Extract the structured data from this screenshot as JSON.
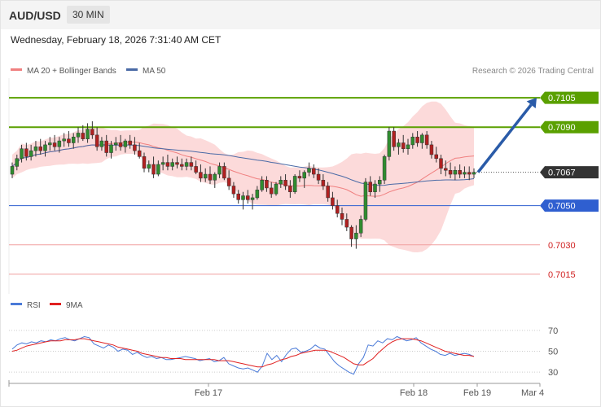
{
  "header": {
    "symbol": "AUD/USD",
    "timeframe": "30 MIN",
    "datetime": "Wednesday, February 18, 2026 7:31:40 AM CET"
  },
  "colors": {
    "bb_fill": "#fbd3d3",
    "ma20": "#f08080",
    "ma50": "#4a6aa6",
    "resistance": "#5aa000",
    "support": "#2f5fd0",
    "weak_level": "#f0a0a0",
    "weak_label": "#d02020",
    "current_label_bg": "#333333",
    "arrow": "#2a5ba8",
    "rsi": "#4a7ad8",
    "rsi_ma": "#e02020",
    "bull_candle": "#2f8c2f",
    "bear_candle": "#b02020"
  },
  "chart_data": [
    {
      "type": "candlestick",
      "legend": [
        {
          "label": "MA 20 + Bollinger Bands",
          "color": "#f08080"
        },
        {
          "label": "MA 50",
          "color": "#4a6aa6"
        }
      ],
      "watermark": "Research © 2026 Trading Central",
      "ylim": [
        0.7005,
        0.7115
      ],
      "x_ticks": [
        "Feb 17",
        "Feb 18",
        "Feb 19",
        "Mar 4"
      ],
      "levels": [
        {
          "value": "0.7105",
          "style": "resistance"
        },
        {
          "value": "0.7090",
          "style": "resistance"
        },
        {
          "value": "0.7067",
          "style": "current"
        },
        {
          "value": "0.7050",
          "style": "support"
        },
        {
          "value": "0.7030",
          "style": "weak"
        },
        {
          "value": "0.7015",
          "style": "weak"
        }
      ],
      "forecast_arrow": {
        "from": 0.7067,
        "to": 0.7105
      },
      "ohlc": [
        [
          0.7066,
          0.7072,
          0.7064,
          0.707
        ],
        [
          0.707,
          0.7076,
          0.7068,
          0.7074
        ],
        [
          0.7074,
          0.7081,
          0.7072,
          0.7079
        ],
        [
          0.7079,
          0.7082,
          0.7073,
          0.7075
        ],
        [
          0.7075,
          0.7081,
          0.7073,
          0.7078
        ],
        [
          0.7078,
          0.7083,
          0.7075,
          0.708
        ],
        [
          0.708,
          0.7084,
          0.7076,
          0.7078
        ],
        [
          0.7078,
          0.7083,
          0.7075,
          0.7081
        ],
        [
          0.7081,
          0.7085,
          0.7078,
          0.7082
        ],
        [
          0.7082,
          0.7086,
          0.7078,
          0.708
        ],
        [
          0.708,
          0.7085,
          0.7077,
          0.7083
        ],
        [
          0.7083,
          0.7087,
          0.708,
          0.7084
        ],
        [
          0.7084,
          0.7088,
          0.708,
          0.7082
        ],
        [
          0.7082,
          0.7087,
          0.7079,
          0.7085
        ],
        [
          0.7085,
          0.709,
          0.7082,
          0.7087
        ],
        [
          0.7087,
          0.7091,
          0.7083,
          0.7084
        ],
        [
          0.7084,
          0.7092,
          0.7082,
          0.7089
        ],
        [
          0.7089,
          0.7093,
          0.7084,
          0.7086
        ],
        [
          0.7086,
          0.709,
          0.7078,
          0.708
        ],
        [
          0.708,
          0.7085,
          0.7078,
          0.7083
        ],
        [
          0.7083,
          0.7086,
          0.7075,
          0.7077
        ],
        [
          0.7077,
          0.7083,
          0.7074,
          0.7081
        ],
        [
          0.7081,
          0.7085,
          0.7078,
          0.7082
        ],
        [
          0.7082,
          0.7086,
          0.7078,
          0.708
        ],
        [
          0.708,
          0.7084,
          0.7077,
          0.7083
        ],
        [
          0.7083,
          0.7086,
          0.7079,
          0.7081
        ],
        [
          0.7081,
          0.7085,
          0.7076,
          0.7078
        ],
        [
          0.7078,
          0.7082,
          0.7074,
          0.7075
        ],
        [
          0.7075,
          0.7077,
          0.7067,
          0.7069
        ],
        [
          0.7069,
          0.7073,
          0.7067,
          0.7071
        ],
        [
          0.7071,
          0.7075,
          0.7064,
          0.7066
        ],
        [
          0.7066,
          0.7073,
          0.7065,
          0.7071
        ],
        [
          0.7071,
          0.7075,
          0.7068,
          0.7072
        ],
        [
          0.7072,
          0.7076,
          0.7068,
          0.707
        ],
        [
          0.707,
          0.7074,
          0.7068,
          0.7072
        ],
        [
          0.7072,
          0.7075,
          0.7069,
          0.7071
        ],
        [
          0.7071,
          0.7074,
          0.7068,
          0.707
        ],
        [
          0.707,
          0.7074,
          0.7068,
          0.7072
        ],
        [
          0.7072,
          0.7075,
          0.7068,
          0.707
        ],
        [
          0.707,
          0.7073,
          0.7066,
          0.7067
        ],
        [
          0.7067,
          0.7071,
          0.7062,
          0.7064
        ],
        [
          0.7064,
          0.7069,
          0.7062,
          0.7066
        ],
        [
          0.7066,
          0.707,
          0.7061,
          0.7063
        ],
        [
          0.7063,
          0.7067,
          0.7059,
          0.7066
        ],
        [
          0.7066,
          0.7072,
          0.7064,
          0.707
        ],
        [
          0.707,
          0.7072,
          0.7063,
          0.7064
        ],
        [
          0.7064,
          0.7068,
          0.7058,
          0.706
        ],
        [
          0.706,
          0.7062,
          0.7054,
          0.7056
        ],
        [
          0.7056,
          0.7058,
          0.7051,
          0.7053
        ],
        [
          0.7053,
          0.7057,
          0.7048,
          0.7055
        ],
        [
          0.7055,
          0.7058,
          0.7051,
          0.7053
        ],
        [
          0.7053,
          0.7056,
          0.7048,
          0.7054
        ],
        [
          0.7054,
          0.706,
          0.7053,
          0.7058
        ],
        [
          0.7058,
          0.7065,
          0.7057,
          0.7063
        ],
        [
          0.7063,
          0.7065,
          0.7057,
          0.7059
        ],
        [
          0.7059,
          0.7062,
          0.7054,
          0.7056
        ],
        [
          0.7056,
          0.7062,
          0.7055,
          0.7061
        ],
        [
          0.7061,
          0.7065,
          0.7059,
          0.7063
        ],
        [
          0.7063,
          0.7066,
          0.7058,
          0.706
        ],
        [
          0.706,
          0.7063,
          0.7054,
          0.7057
        ],
        [
          0.7057,
          0.7066,
          0.7056,
          0.7065
        ],
        [
          0.7065,
          0.7068,
          0.7062,
          0.7064
        ],
        [
          0.7064,
          0.7068,
          0.7059,
          0.7067
        ],
        [
          0.7067,
          0.7072,
          0.7065,
          0.7069
        ],
        [
          0.7069,
          0.7071,
          0.7064,
          0.7066
        ],
        [
          0.7066,
          0.7069,
          0.7061,
          0.7063
        ],
        [
          0.7063,
          0.7066,
          0.7058,
          0.706
        ],
        [
          0.706,
          0.7062,
          0.7052,
          0.7054
        ],
        [
          0.7054,
          0.7057,
          0.7048,
          0.705
        ],
        [
          0.705,
          0.7053,
          0.7044,
          0.7046
        ],
        [
          0.7046,
          0.7049,
          0.704,
          0.7043
        ],
        [
          0.7043,
          0.7046,
          0.7037,
          0.7039
        ],
        [
          0.7039,
          0.704,
          0.7029,
          0.7033
        ],
        [
          0.7033,
          0.704,
          0.7028,
          0.7036
        ],
        [
          0.7036,
          0.7045,
          0.7034,
          0.7043
        ],
        [
          0.7043,
          0.7064,
          0.7042,
          0.7062
        ],
        [
          0.7062,
          0.7065,
          0.7055,
          0.7057
        ],
        [
          0.7057,
          0.7063,
          0.7054,
          0.7061
        ],
        [
          0.7061,
          0.7065,
          0.7057,
          0.7063
        ],
        [
          0.7063,
          0.7076,
          0.7061,
          0.7075
        ],
        [
          0.7075,
          0.709,
          0.7073,
          0.7088
        ],
        [
          0.7088,
          0.709,
          0.7078,
          0.708
        ],
        [
          0.708,
          0.7084,
          0.7076,
          0.7082
        ],
        [
          0.7082,
          0.7086,
          0.7077,
          0.7079
        ],
        [
          0.7079,
          0.7084,
          0.7076,
          0.7081
        ],
        [
          0.7081,
          0.7087,
          0.7079,
          0.7085
        ],
        [
          0.7085,
          0.7088,
          0.708,
          0.7082
        ],
        [
          0.7082,
          0.7087,
          0.7079,
          0.7086
        ],
        [
          0.7086,
          0.7088,
          0.7079,
          0.7081
        ],
        [
          0.7081,
          0.7083,
          0.7074,
          0.7076
        ],
        [
          0.7076,
          0.708,
          0.7072,
          0.7074
        ],
        [
          0.7074,
          0.7076,
          0.7066,
          0.7069
        ],
        [
          0.7069,
          0.7073,
          0.7065,
          0.7068
        ],
        [
          0.7068,
          0.7072,
          0.7064,
          0.7066
        ],
        [
          0.7066,
          0.707,
          0.7063,
          0.7068
        ],
        [
          0.7068,
          0.7071,
          0.7064,
          0.7066
        ],
        [
          0.7066,
          0.707,
          0.7064,
          0.7067
        ],
        [
          0.7067,
          0.707,
          0.7063,
          0.7066
        ],
        [
          0.7066,
          0.7069,
          0.7064,
          0.7067
        ]
      ]
    },
    {
      "type": "line",
      "name": "RSI panel",
      "legend": [
        {
          "label": "RSI",
          "color": "#4a7ad8"
        },
        {
          "label": "9MA",
          "color": "#e02020"
        }
      ],
      "ylim": [
        20,
        80
      ],
      "y_ticks": [
        "70",
        "50",
        "30"
      ],
      "series": [
        {
          "name": "RSI",
          "values": [
            52,
            56,
            58,
            57,
            59,
            58,
            60,
            59,
            61,
            60,
            62,
            63,
            61,
            60,
            62,
            64,
            63,
            57,
            55,
            53,
            56,
            54,
            50,
            52,
            51,
            47,
            49,
            46,
            44,
            45,
            43,
            44,
            42,
            42,
            43,
            44,
            45,
            44,
            43,
            41,
            42,
            43,
            40,
            41,
            44,
            38,
            36,
            34,
            33,
            34,
            32,
            30,
            36,
            48,
            42,
            46,
            40,
            47,
            52,
            53,
            49,
            50,
            52,
            56,
            53,
            52,
            46,
            40,
            36,
            33,
            30,
            28,
            38,
            44,
            56,
            55,
            60,
            58,
            62,
            61,
            64,
            62,
            60,
            61,
            63,
            58,
            55,
            52,
            50,
            47,
            46,
            48,
            46,
            47,
            48,
            47,
            45
          ]
        },
        {
          "name": "9MA",
          "values": [
            50,
            51,
            53,
            55,
            56,
            57,
            58,
            59,
            60,
            60,
            60,
            61,
            61,
            61,
            62,
            62,
            61,
            60,
            59,
            58,
            57,
            56,
            54,
            53,
            52,
            51,
            50,
            48,
            47,
            46,
            45,
            44,
            44,
            43,
            43,
            43,
            42,
            42,
            42,
            42,
            42,
            42,
            42,
            41,
            41,
            41,
            40,
            39,
            38,
            37,
            36,
            35,
            35,
            37,
            38,
            40,
            42,
            43,
            45,
            46,
            48,
            49,
            50,
            51,
            51,
            51,
            50,
            48,
            46,
            44,
            41,
            38,
            37,
            37,
            40,
            43,
            48,
            52,
            56,
            59,
            61,
            62,
            62,
            62,
            61,
            60,
            58,
            56,
            54,
            52,
            50,
            49,
            48,
            47,
            46,
            46,
            45
          ]
        }
      ]
    }
  ]
}
